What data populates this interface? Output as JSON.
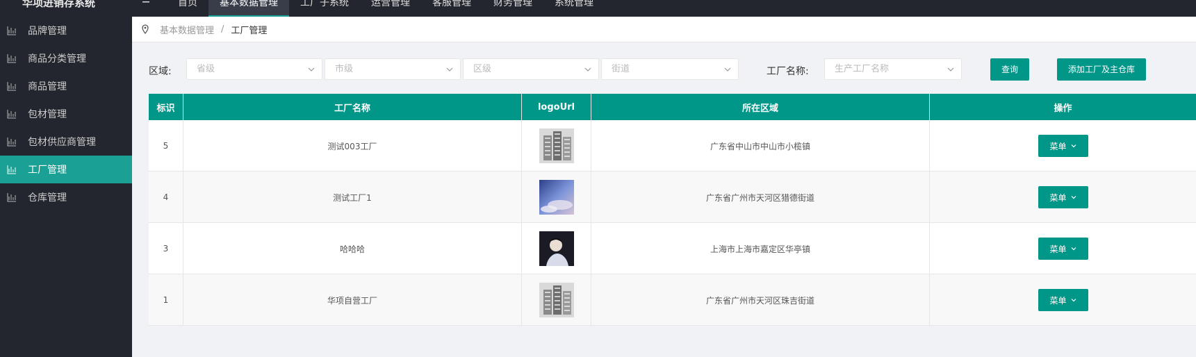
{
  "app": {
    "title": "华项进销存系统"
  },
  "topnav": {
    "toggle_icon": "menu-lines-icon",
    "items": [
      {
        "label": "首页"
      },
      {
        "label": "基本数据管理",
        "active": true
      },
      {
        "label": "工厂子系统"
      },
      {
        "label": "运营管理"
      },
      {
        "label": "客服管理"
      },
      {
        "label": "财务管理"
      },
      {
        "label": "系统管理"
      }
    ]
  },
  "sidebar": {
    "items": [
      {
        "label": "品牌管理",
        "icon": "chart-icon"
      },
      {
        "label": "商品分类管理",
        "icon": "chart-icon"
      },
      {
        "label": "商品管理",
        "icon": "chart-icon"
      },
      {
        "label": "包材管理",
        "icon": "chart-icon"
      },
      {
        "label": "包材供应商管理",
        "icon": "chart-icon"
      },
      {
        "label": "工厂管理",
        "icon": "chart-icon",
        "active": true
      },
      {
        "label": "仓库管理",
        "icon": "chart-icon"
      }
    ]
  },
  "breadcrumb": {
    "icon": "location-pin-icon",
    "parent": "基本数据管理",
    "separator": "/",
    "current": "工厂管理"
  },
  "filters": {
    "region_label": "区域:",
    "province": {
      "placeholder": "省级"
    },
    "city": {
      "placeholder": "市级"
    },
    "district": {
      "placeholder": "区级"
    },
    "street": {
      "placeholder": "街道"
    },
    "factory_label": "工厂名称:",
    "factory": {
      "placeholder": "生产工厂名称"
    },
    "search_button": "查询",
    "add_button": "添加工厂及主仓库"
  },
  "table": {
    "headers": [
      "标识",
      "工厂名称",
      "logoUrl",
      "所在区域",
      "操作"
    ],
    "action_label": "菜单",
    "rows": [
      {
        "id": "5",
        "name": "测试003工厂",
        "logo": "building-image",
        "region": "广东省中山市中山市小榄镇"
      },
      {
        "id": "4",
        "name": "测试工厂1",
        "logo": "sky-image",
        "region": "广东省广州市天河区猎德街道"
      },
      {
        "id": "3",
        "name": "哈哈哈",
        "logo": "portrait-image",
        "region": "上海市上海市嘉定区华亭镇"
      },
      {
        "id": "1",
        "name": "华项自营工厂",
        "logo": "building-image",
        "region": "广东省广州市天河区珠吉街道"
      }
    ]
  },
  "colors": {
    "accent": "#009688",
    "sidebar_bg": "#23262e",
    "sidebar_active": "#1aa094"
  }
}
